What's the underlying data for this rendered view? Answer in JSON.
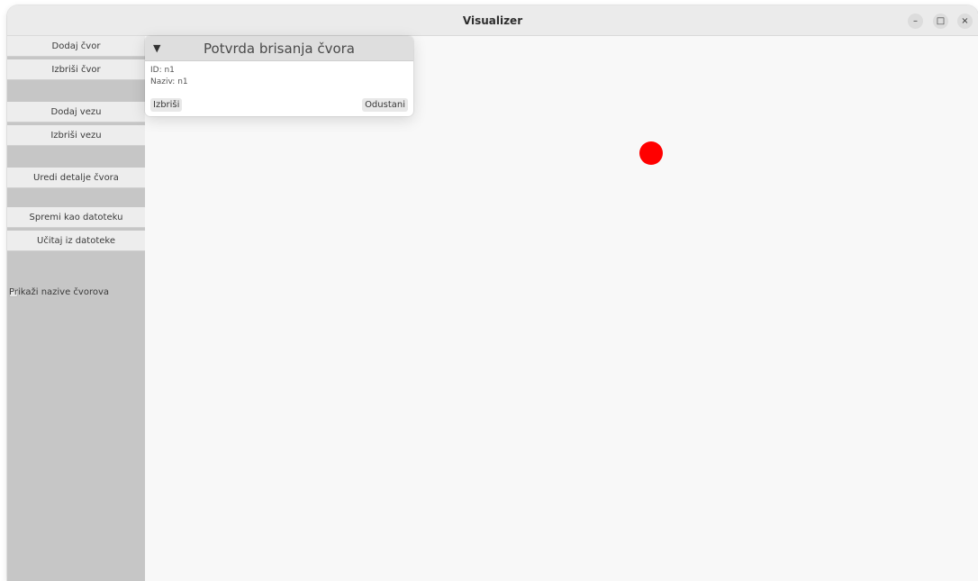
{
  "window": {
    "title": "Visualizer",
    "controls": {
      "minimize": "–",
      "maximize": "□",
      "close": "×"
    }
  },
  "sidebar": {
    "buttons": [
      {
        "label": "Dodaj čvor"
      },
      {
        "label": "Izbriši čvor"
      },
      {
        "label": "Dodaj vezu"
      },
      {
        "label": "Izbriši vezu"
      },
      {
        "label": "Uredi detalje čvora"
      },
      {
        "label": "Spremi kao datoteku"
      },
      {
        "label": "Učitaj iz datoteke"
      }
    ],
    "checkbox": {
      "label": "Prikaži nazive čvorova",
      "checked": false
    }
  },
  "dialog": {
    "arrow": "▼",
    "title": "Potvrda brisanja čvora",
    "id_line": "ID: n1",
    "name_line": "Naziv: n1",
    "delete_label": "Izbriši",
    "cancel_label": "Odustani"
  },
  "graph": {
    "nodes": [
      {
        "id": "n1",
        "color": "#ff0000"
      }
    ]
  }
}
